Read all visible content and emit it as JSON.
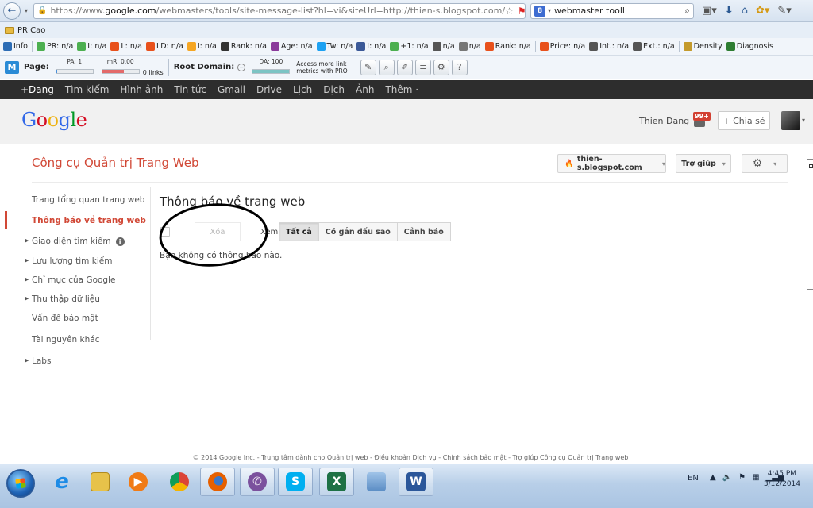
{
  "browser": {
    "url_prefix": "https://www.",
    "url_domain": "google.com",
    "url_rest": "/webmasters/tools/site-message-list?hl=vi&siteUrl=http://thien-s.blogspot.com/",
    "search_engine_icon": "8",
    "search_value": "webmaster tooll"
  },
  "bookmarks": {
    "folder_label": "PR Cao"
  },
  "seo_toolbar": {
    "items": [
      {
        "label": "Info",
        "color": "#2d6db5"
      },
      {
        "label": "PR: n/a",
        "color": "#4caf50"
      },
      {
        "label": "I: n/a",
        "color": "#4caf50"
      },
      {
        "label": "L: n/a",
        "color": "#e8511c"
      },
      {
        "label": "LD: n/a",
        "color": "#e8511c"
      },
      {
        "label": "I: n/a",
        "color": "#f5a623"
      },
      {
        "label": "Rank: n/a",
        "color": "#333333"
      },
      {
        "label": "Age: n/a",
        "color": "#8a3a9b"
      },
      {
        "label": "Tw: n/a",
        "color": "#1da1f2"
      },
      {
        "label": "I: n/a",
        "color": "#3b5998"
      },
      {
        "label": "+1: n/a",
        "color": "#4caf50"
      },
      {
        "label": "n/a",
        "color": "#555555"
      },
      {
        "label": "n/a",
        "color": "#777777"
      },
      {
        "label": "Rank: n/a",
        "color": "#e8511c"
      },
      {
        "label": "Price: n/a",
        "color": "#e8511c"
      },
      {
        "label": "Int.: n/a",
        "color": "#555555"
      },
      {
        "label": "Ext.: n/a",
        "color": "#555555"
      },
      {
        "label": "Density",
        "color": "#c49a2c"
      },
      {
        "label": "Diagnosis",
        "color": "#2e7d32"
      }
    ]
  },
  "mozbar": {
    "logo": "M",
    "page_label": "Page:",
    "pa_label": "PA: 1",
    "pa_fill": 0.01,
    "mr_label": "mR: 0.00",
    "mr_fill": 0.6,
    "links_label": "0 links",
    "root_domain_label": "Root Domain:",
    "da_label": "DA: 100",
    "da_fill": 1.0,
    "access_line1": "Access more link",
    "access_line2": "metrics with PRO"
  },
  "google_bar": {
    "items": [
      "+Dang",
      "Tìm kiếm",
      "Hình ảnh",
      "Tin tức",
      "Gmail",
      "Drive",
      "Lịch",
      "Dịch",
      "Ảnh",
      "Thêm ·"
    ]
  },
  "google_header": {
    "logo_letters": [
      "G",
      "o",
      "o",
      "g",
      "l",
      "e"
    ],
    "logo_colors": [
      "#3369e8",
      "#d50f25",
      "#eeb211",
      "#3369e8",
      "#009925",
      "#d50f25"
    ],
    "user_name": "Thien Dang",
    "notification_count": "99+",
    "share_label": "+ Chia sẻ"
  },
  "wmt": {
    "title": "Công cụ Quản trị Trang Web",
    "site_select": "thien-s.blogspot.com",
    "help_label": "Trợ giúp"
  },
  "sidebar": {
    "items": [
      {
        "label": "Trang tổng quan trang web"
      },
      {
        "label": "Thông báo về trang web"
      },
      {
        "label": "Giao diện tìm kiếm"
      },
      {
        "label": "Lưu lượng tìm kiếm"
      },
      {
        "label": "Chỉ mục của Google"
      },
      {
        "label": "Thu thập dữ liệu"
      },
      {
        "label": "Vấn đề bảo mật"
      },
      {
        "label": "Tài nguyên khác"
      },
      {
        "label": "Labs"
      }
    ]
  },
  "content": {
    "title": "Thông báo về trang web",
    "delete_label": "Xóa",
    "view_label": "Xem",
    "filters": [
      "Tất cả",
      "Có gắn dấu sao",
      "Cảnh báo"
    ],
    "empty_message": "Bạn không có thông báo nào."
  },
  "footer": {
    "text": "© 2014 Google Inc. - Trung tâm dành cho Quản trị web - Điều khoản Dịch vụ - Chính sách bảo mật - Trợ giúp Công cụ Quản trị Trang web"
  },
  "taskbar": {
    "language": "EN",
    "time": "4:45 PM",
    "date": "3/12/2014"
  }
}
